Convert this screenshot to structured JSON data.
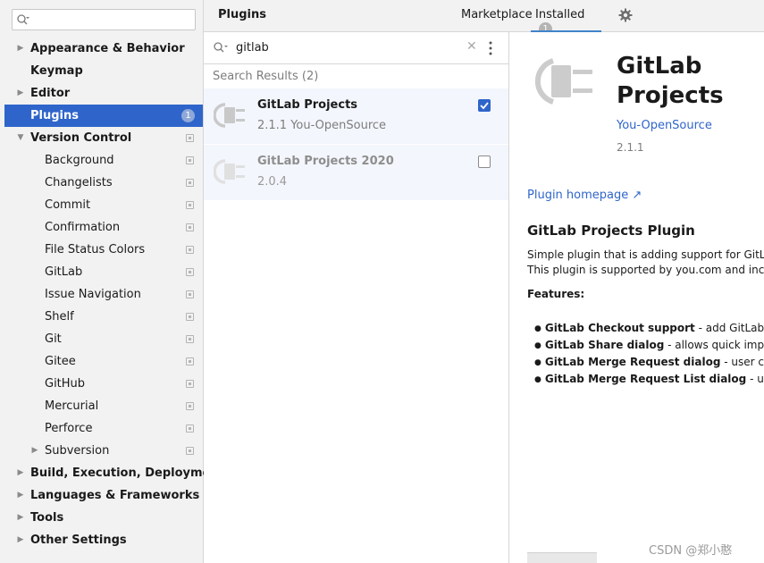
{
  "sidebar": {
    "search": {
      "value": ""
    },
    "items": [
      {
        "label": "Appearance & Behavior",
        "bold": true,
        "arrow": "right",
        "sub": false
      },
      {
        "label": "Keymap",
        "bold": true,
        "arrow": "",
        "sub": false
      },
      {
        "label": "Editor",
        "bold": true,
        "arrow": "right",
        "sub": false
      },
      {
        "label": "Plugins",
        "bold": true,
        "arrow": "",
        "sub": false,
        "selected": true,
        "badge": "1"
      },
      {
        "label": "Version Control",
        "bold": true,
        "arrow": "down",
        "sub": false,
        "copy": true
      },
      {
        "label": "Background",
        "sub": true,
        "copy": true
      },
      {
        "label": "Changelists",
        "sub": true,
        "copy": true
      },
      {
        "label": "Commit",
        "sub": true,
        "copy": true
      },
      {
        "label": "Confirmation",
        "sub": true,
        "copy": true
      },
      {
        "label": "File Status Colors",
        "sub": true,
        "copy": true
      },
      {
        "label": "GitLab",
        "sub": true,
        "copy": true
      },
      {
        "label": "Issue Navigation",
        "sub": true,
        "copy": true
      },
      {
        "label": "Shelf",
        "sub": true,
        "copy": true
      },
      {
        "label": "Git",
        "sub": true,
        "copy": true
      },
      {
        "label": "Gitee",
        "sub": true,
        "copy": true
      },
      {
        "label": "GitHub",
        "sub": true,
        "copy": true
      },
      {
        "label": "Mercurial",
        "sub": true,
        "copy": true
      },
      {
        "label": "Perforce",
        "sub": true,
        "copy": true
      },
      {
        "label": "Subversion",
        "sub": true,
        "arrow": "right",
        "copy": true
      },
      {
        "label": "Build, Execution, Deployment",
        "bold": true,
        "arrow": "right",
        "sub": false
      },
      {
        "label": "Languages & Frameworks",
        "bold": true,
        "arrow": "right",
        "sub": false
      },
      {
        "label": "Tools",
        "bold": true,
        "arrow": "right",
        "sub": false
      },
      {
        "label": "Other Settings",
        "bold": true,
        "arrow": "right",
        "sub": false
      }
    ]
  },
  "header": {
    "title": "Plugins",
    "tab_marketplace": "Marketplace",
    "tab_installed": "Installed",
    "installed_count": "1",
    "gear_icon": "gear-icon"
  },
  "list": {
    "query": "gitlab",
    "results_label": "Search Results (2)",
    "plugins": [
      {
        "name": "GitLab Projects",
        "meta": "2.1.1  You-OpenSource",
        "enabled": true
      },
      {
        "name": "GitLab Projects 2020",
        "meta": "2.0.4",
        "enabled": false
      }
    ]
  },
  "details": {
    "title": "GitLab Projects",
    "vendor": "You-OpenSource",
    "version": "2.1.1",
    "homepage": "Plugin homepage ↗",
    "plugin_title": "GitLab Projects Plugin",
    "desc_line1": "Simple plugin that is adding support for GitLa",
    "desc_line2": "This plugin is supported by you.com and inclu",
    "features_label": "Features:",
    "features": [
      {
        "bold": "GitLab Checkout support",
        "rest": " - add GitLab au"
      },
      {
        "bold": "GitLab Share dialog",
        "rest": " - allows quick impor"
      },
      {
        "bold": "GitLab Merge Request dialog",
        "rest": " - user can"
      },
      {
        "bold": "GitLab Merge Request List dialog",
        "rest": " - user"
      }
    ]
  },
  "watermark": "CSDN @郑小憨",
  "colors": {
    "accent": "#2f65ca",
    "selection": "#2f65ca",
    "link": "#2f65ca"
  }
}
